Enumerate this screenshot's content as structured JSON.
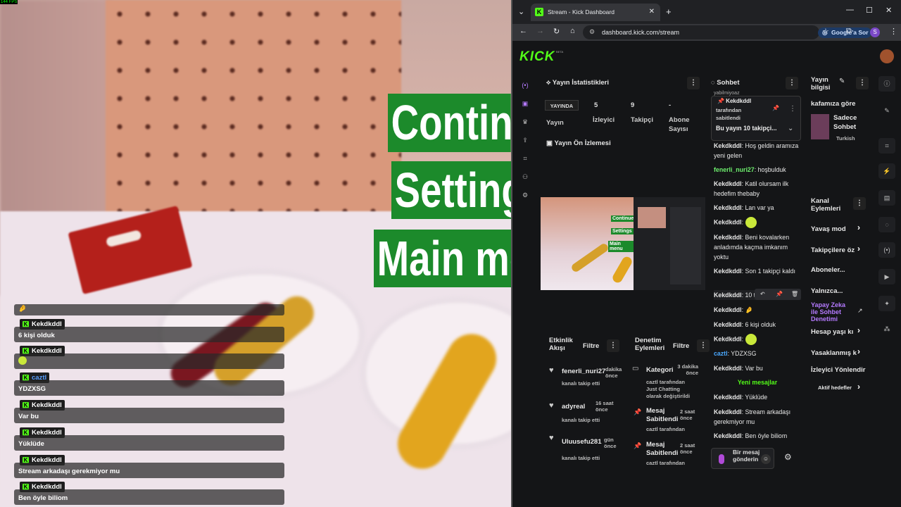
{
  "overlay": {
    "fps": "144 FPS",
    "menu": [
      "Continue",
      "Settings",
      "Main menu"
    ],
    "rows": [
      {
        "name": "",
        "text": "🤌"
      },
      {
        "name": "Kekdkddl",
        "text": "6 kişi olduk"
      },
      {
        "name": "Kekdkddl",
        "text": ""
      },
      {
        "name": "caztl",
        "text": "YDZXSG"
      },
      {
        "name": "Kekdkddl",
        "text": "Var bu"
      },
      {
        "name": "Kekdkddl",
        "text": "Yüklüde"
      },
      {
        "name": "Kekdkddl",
        "text": "Stream arkadaşı gerekmiyor mu"
      },
      {
        "name": "Kekdkddl",
        "text": "Ben öyle biliom"
      }
    ]
  },
  "browser": {
    "tab_title": "Stream - Kick Dashboard",
    "url": "dashboard.kick.com/stream",
    "google_btn": "Google'a Sor",
    "profile_letter": "S"
  },
  "stats": {
    "title": "Yayın İstatistikleri",
    "live_badge": "YAYINDA",
    "values": [
      {
        "label": "Yayın",
        "value": ""
      },
      {
        "label": "İzleyici",
        "value": "5"
      },
      {
        "label": "Takipçi",
        "value": "9"
      },
      {
        "label": "Abone\nSayısı",
        "value": "-"
      }
    ],
    "preview_title": "Yayın Ön İzlemesi"
  },
  "activity": {
    "title": "Etkinlik\nAkışı",
    "filter": "Filtre",
    "items": [
      {
        "name": "fenerli_nuri27",
        "time": "dakika\nönce",
        "desc": "kanalı takip etti"
      },
      {
        "name": "adyreal",
        "time": "16 saat\nönce",
        "desc": "kanalı takip etti"
      },
      {
        "name": "Uluusefu281",
        "time": "gün\nönce",
        "desc": "kanalı takip etti"
      }
    ]
  },
  "moderation": {
    "title": "Denetim\nEylemleri",
    "filter": "Filtre",
    "items": [
      {
        "name": "Kategori",
        "time": "3 dakika\nönce",
        "desc": "caztl tarafından\nJust Chatting\nolarak değiştirildi"
      },
      {
        "name": "Mesaj\nSabitlendi",
        "time": "2 saat\nönce",
        "desc": "caztl tarafından"
      },
      {
        "name": "Mesaj\nSabitlendi",
        "time": "2 saat\nönce",
        "desc": "caztl tarafından"
      }
    ]
  },
  "chat": {
    "title": "Sohbet",
    "top_fragment": "yabilmiyoaz",
    "pinned": {
      "by": "Kekdkddl",
      "meta": "tarafından\nsabitlendi",
      "text": "Bu yayın 10 takipçi..."
    },
    "messages": [
      {
        "name": "Kekdkddl",
        "text": "Hoş geldin aramıza yeni gelen"
      },
      {
        "name": "fenerli_nuri27",
        "text": "hoşbulduk"
      },
      {
        "name": "Kekdkddl",
        "text": "Katil olursam ilk hedefim thebaby"
      },
      {
        "name": "Kekdkddl",
        "text": "Lan var ya"
      },
      {
        "name": "Kekdkddl",
        "text": ""
      },
      {
        "name": "Kekdkddl",
        "text": "Beni kovalarken anladımda kaçma imkanım yoktu"
      },
      {
        "name": "Kekdkddl",
        "text": "Son 1 takipçi kaldı"
      },
      {
        "name": "Kekdkddl",
        "text": "10 takipçi"
      },
      {
        "name": "Kekdkddl",
        "text": "🤌"
      },
      {
        "name": "Kekdkddl",
        "text": "6 kişi olduk"
      },
      {
        "name": "Kekdkddl",
        "text": ""
      },
      {
        "name": "caztl",
        "text": "YDZXSG"
      },
      {
        "name": "Kekdkddl",
        "text": "Var bu"
      },
      {
        "name": "Kekdkddl",
        "text": "Yüklüde"
      },
      {
        "name": "Kekdkddl",
        "text": "Stream arkadaşı gerekmiyor mu"
      },
      {
        "name": "Kekdkddl",
        "text": "Ben öyle biliom"
      }
    ],
    "new_messages": "Yeni mesajlar",
    "input_placeholder": "Bir mesaj gönderin"
  },
  "stream_info": {
    "title": "Yayın\nbilgisi",
    "stream_title": "kafamıza göre",
    "category": "Sadece\nSohbet",
    "language": "Turkish"
  },
  "channel_actions": {
    "title": "Kanal\nEylemleri",
    "items": [
      "Yavaş mod",
      "Takipçilere öz",
      "Aboneler...",
      "Yalnızca...",
      "Yapay Zeka ile Sohbet Denetimi",
      "Hesap yaşı kı",
      "Yasaklanmış k",
      "İzleyici Yönlendir",
      "Aktif hedefler"
    ]
  }
}
